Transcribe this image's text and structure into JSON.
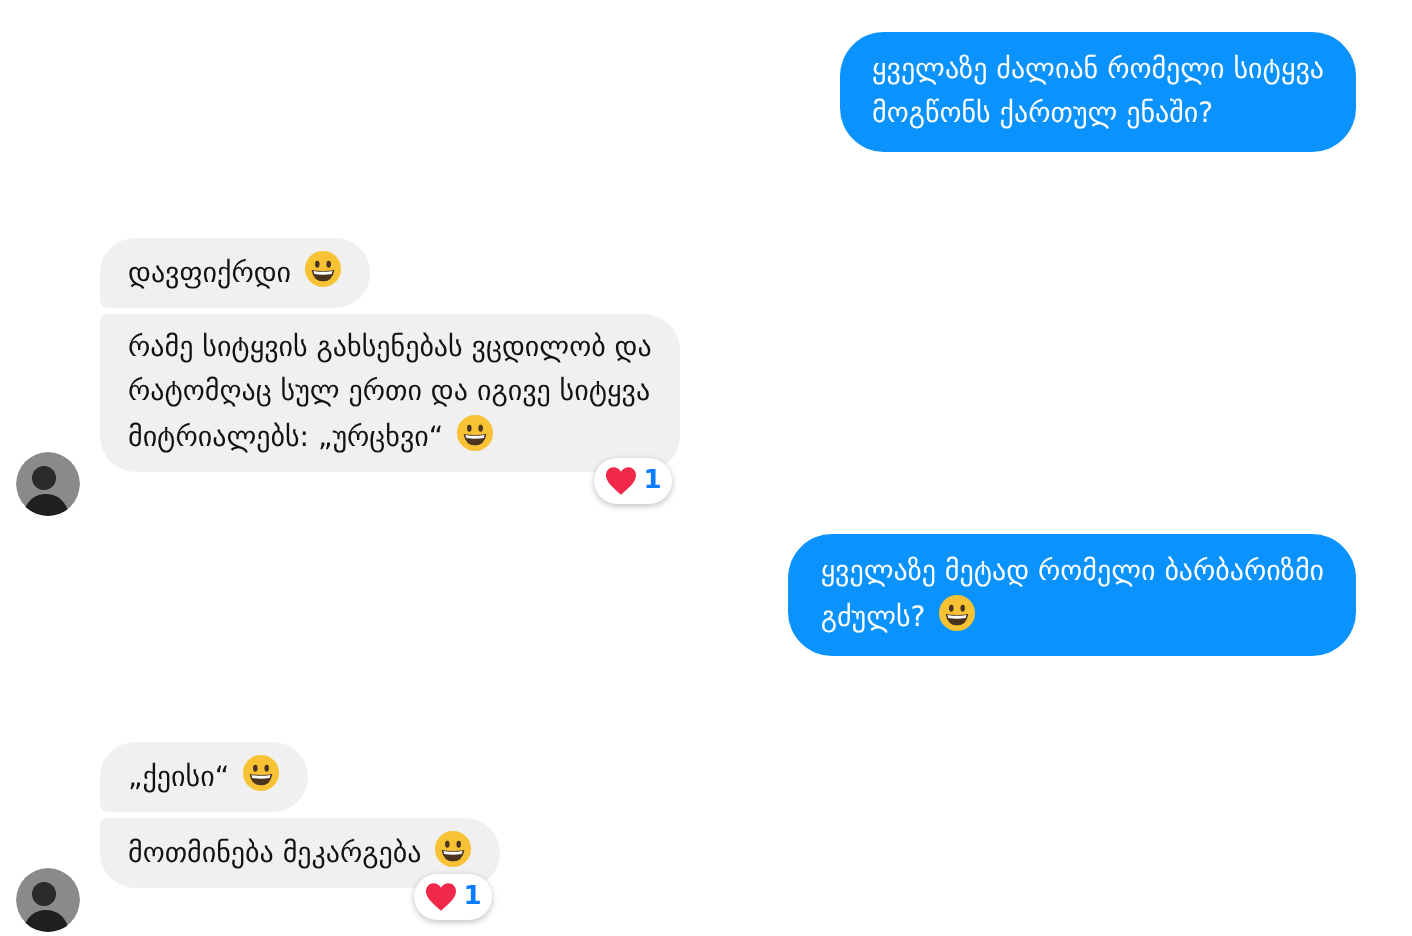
{
  "groups": [
    {
      "kind": "sent",
      "bubbles": [
        {
          "lines": [
            "ყველაზე ძალიან რომელი სიტყვა",
            "მოგწონს ქართულ ენაში?"
          ],
          "emoji": false
        }
      ]
    },
    {
      "kind": "received",
      "bubbles": [
        {
          "lines": [
            "დავფიქრდი"
          ],
          "emoji": true
        },
        {
          "lines": [
            "რამე სიტყვის გახსენებას ვცდილობ და",
            "რატომღაც სულ ერთი და იგივე სიტყვა",
            "მიტრიალებს: „ურცხვი“"
          ],
          "emoji": true,
          "reaction": {
            "count": "1"
          }
        }
      ]
    },
    {
      "kind": "sent",
      "bubbles": [
        {
          "lines": [
            "ყველაზე მეტად რომელი ბარბარიზმი",
            "გძულს?"
          ],
          "emoji": true
        }
      ]
    },
    {
      "kind": "received",
      "bubbles": [
        {
          "lines": [
            "„ქეისი“"
          ],
          "emoji": true
        },
        {
          "lines": [
            "მოთმინება მეკარგება"
          ],
          "emoji": true,
          "reaction": {
            "count": "1"
          }
        }
      ]
    }
  ]
}
